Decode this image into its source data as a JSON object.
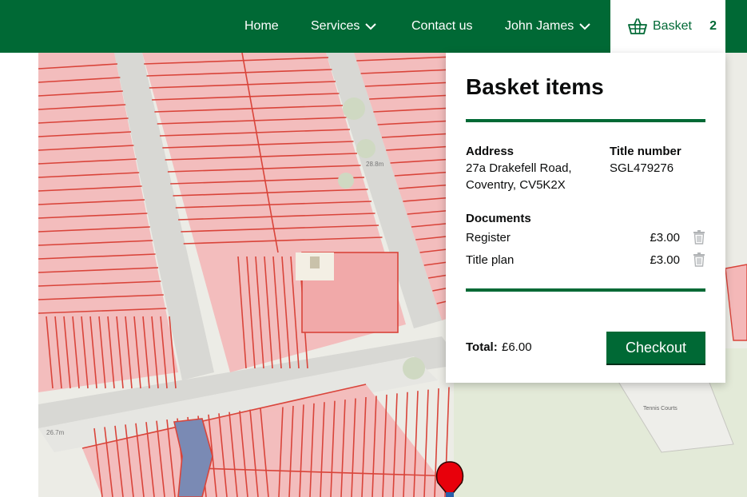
{
  "nav": {
    "home": "Home",
    "services": "Services",
    "contact": "Contact us",
    "user": "John James",
    "basket_label": "Basket",
    "basket_count": "2"
  },
  "map": {
    "label_height_1": "28.8m",
    "label_height_2": "26.7m",
    "label_tennis": "Tennis Courts"
  },
  "basket": {
    "title": "Basket items",
    "address_label": "Address",
    "address_value": "27a Drakefell Road, Coventry, CV5K2X",
    "title_number_label": "Title number",
    "title_number_value": "SGL479276",
    "documents_label": "Documents",
    "documents": [
      {
        "name": "Register",
        "price": "£3.00"
      },
      {
        "name": "Title plan",
        "price": "£3.00"
      }
    ],
    "total_label": "Total:",
    "total_value": "£6.00",
    "checkout_label": "Checkout"
  },
  "colors": {
    "brand_green": "#006935",
    "parcel_fill": "#f4b8b8",
    "parcel_stroke": "#d9443a",
    "selected_parcel": "#7a8ab4",
    "marker_red": "#e8000b",
    "icon_grey": "#b1b4b6"
  },
  "icons": {
    "basket": "basket-icon",
    "chevron": "chevron-down-icon",
    "delete": "trash-icon",
    "marker": "map-pin-icon"
  }
}
